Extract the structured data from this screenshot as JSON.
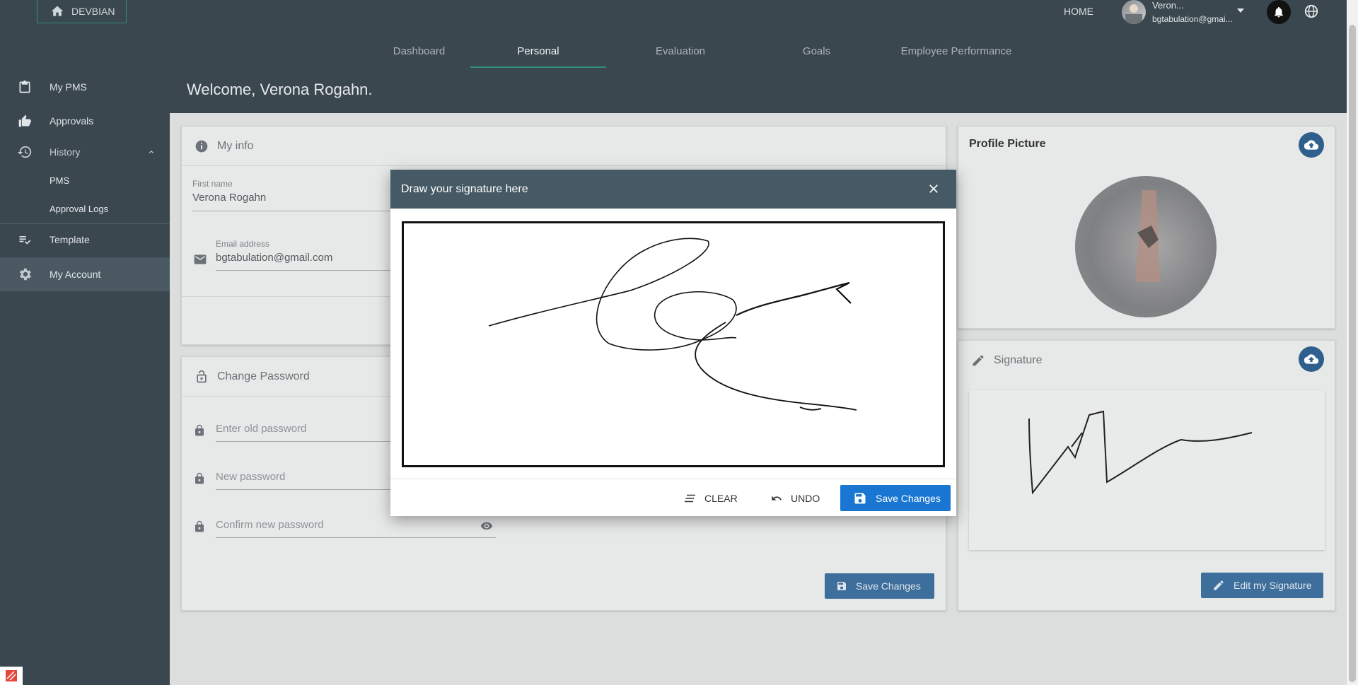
{
  "brand": {
    "label": "DEVBIAN"
  },
  "header": {
    "home_label": "HOME",
    "user_name": "Veron...",
    "user_email": "bgtabulation@gmai..."
  },
  "tabs": [
    {
      "label": "Dashboard",
      "active": false
    },
    {
      "label": "Personal",
      "active": true
    },
    {
      "label": "Evaluation",
      "active": false
    },
    {
      "label": "Goals",
      "active": false
    },
    {
      "label": "Employee Performance",
      "active": false
    }
  ],
  "welcome": "Welcome, Verona Rogahn.",
  "sidebar": {
    "items": [
      {
        "label": "My PMS",
        "icon": "clipboard-icon"
      },
      {
        "label": "Approvals",
        "icon": "thumbs-icon"
      },
      {
        "label": "History",
        "icon": "history-icon"
      },
      {
        "label": "PMS"
      },
      {
        "label": "Approval Logs"
      },
      {
        "label": "Template",
        "icon": "checklist-icon"
      },
      {
        "label": "My Account",
        "icon": "gear-icon"
      }
    ]
  },
  "my_info": {
    "title": "My info",
    "first_name_label": "First name",
    "first_name_value": "Verona Rogahn",
    "email_label": "Email address",
    "email_value": "bgtabulation@gmail.com"
  },
  "change_password": {
    "title": "Change Password",
    "old_placeholder": "Enter old password",
    "new_placeholder": "New password",
    "confirm_placeholder": "Confirm new password",
    "save_label": "Save Changes"
  },
  "profile_picture": {
    "title": "Profile Picture"
  },
  "signature_card": {
    "title": "Signature",
    "edit_label": "Edit my Signature"
  },
  "modal": {
    "title": "Draw your signature here",
    "clear_label": "CLEAR",
    "undo_label": "UNDO",
    "save_label": "Save Changes"
  },
  "colors": {
    "header_bg": "#3b474f",
    "accent_teal": "#2f8d7f",
    "primary_blue": "#1976d2",
    "modal_head": "#455a64"
  }
}
